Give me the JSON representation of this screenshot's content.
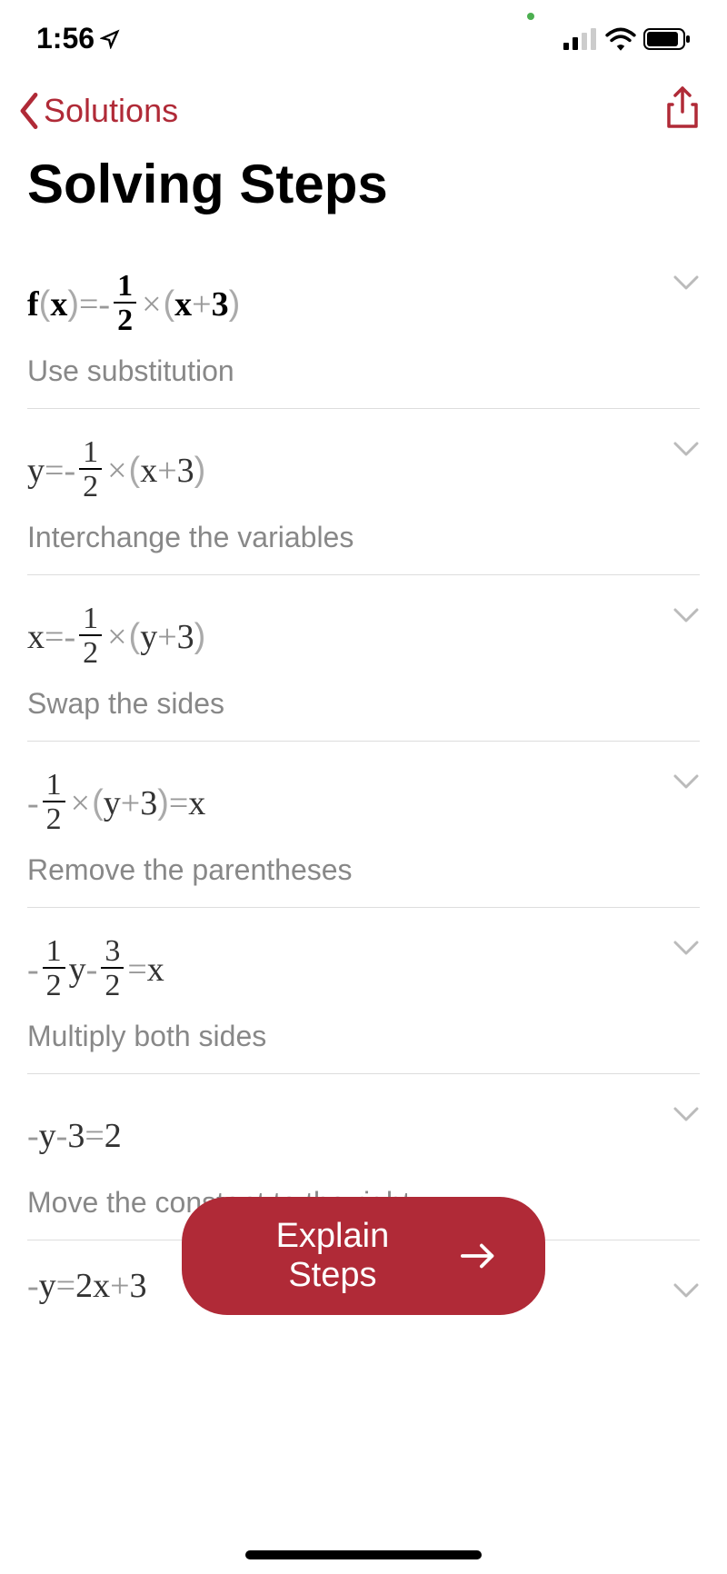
{
  "status": {
    "time": "1:56"
  },
  "nav": {
    "back_label": "Solutions"
  },
  "title": "Solving Steps",
  "steps": [
    {
      "description": "Use substitution"
    },
    {
      "description": "Interchange the variables"
    },
    {
      "description": "Swap the sides"
    },
    {
      "description": "Remove the parentheses"
    },
    {
      "description": "Multiply both sides"
    },
    {
      "description": "Move the constant to the right"
    }
  ],
  "explain_button": "Explain Steps"
}
